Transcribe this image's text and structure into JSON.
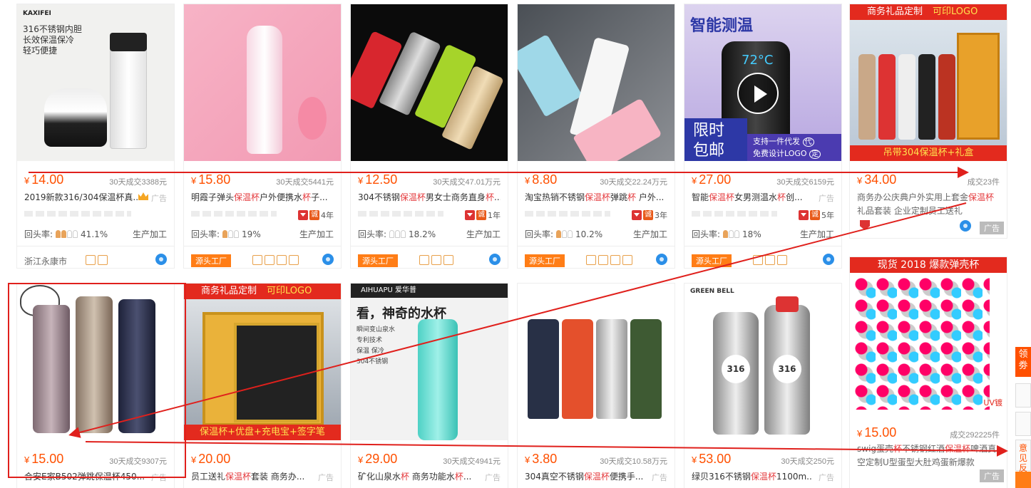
{
  "row1": [
    {
      "price": "15.00",
      "yen": "¥",
      "sales": "30天成交9307元",
      "title": "合安E家B502弹跳保温杯450...",
      "ad": "广告"
    },
    {
      "price": "20.00",
      "yen": "¥",
      "sales": "",
      "title_pre": "员工送礼",
      "title_hl": "保温杯",
      "title_post": "套装 商务办...",
      "ad": "广告"
    },
    {
      "price": "29.00",
      "yen": "¥",
      "sales": "30天成交4941元",
      "title_pre": "矿化山泉水",
      "title_hl": "杯",
      "title_post": " 商务功能水",
      "title_hl2": "杯",
      "title_post2": "...",
      "ad": "广告"
    },
    {
      "price": "3.80",
      "yen": "¥",
      "sales": "30天成交10.58万元",
      "title_pre": "304真空不锈钢",
      "title_hl": "保温杯",
      "title_post": "便携手...",
      "ad": "广告"
    },
    {
      "price": "53.00",
      "yen": "¥",
      "sales": "30天成交250元",
      "title_pre": "绿贝316不锈钢",
      "title_hl": "保温杯",
      "title_post": "1100m...",
      "ad": "广告"
    }
  ],
  "row0": [
    {
      "price": "14.00",
      "yen": "¥",
      "sales": "30天成交3388元",
      "title": "2019新款316/304保温杯真...",
      "ad": "广告",
      "rate": "41.1%",
      "type": "生产加工",
      "rank": "",
      "location": "浙江永康市",
      "img_text": [
        "316不锈钢内胆",
        "长效保温保冷",
        "轻巧便捷"
      ],
      "brand": "KAXIFEI"
    },
    {
      "price": "15.80",
      "yen": "¥",
      "sales": "30天成交5441元",
      "title_pre": "明霞子弹头",
      "title_hl": "保温杯",
      "title_post": "户外便携水",
      "title_hl2": "杯",
      "title_post2": "子...",
      "ad": "",
      "rate": "19%",
      "type": "生产加工",
      "rank": "4年",
      "src": "源头工厂"
    },
    {
      "price": "12.50",
      "yen": "¥",
      "sales": "30天成交47.01万元",
      "title_pre": "304不锈钢",
      "title_hl": "保温杯",
      "title_post": "男女士商务直身",
      "title_hl2": "杯",
      "title_post2": "...",
      "ad": "",
      "rate": "18.2%",
      "type": "生产加工",
      "rank": "1年",
      "src": "源头工厂"
    },
    {
      "price": "8.80",
      "yen": "¥",
      "sales": "30天成交22.24万元",
      "title_pre": "淘宝热销不锈钢",
      "title_hl": "保温杯",
      "title_post": "弹跳",
      "title_hl2": "杯",
      "title_post2": " 户外...",
      "ad": "",
      "rate": "10.2%",
      "type": "生产加工",
      "rank": "3年",
      "src": "源头工厂"
    },
    {
      "price": "27.00",
      "yen": "¥",
      "sales": "30天成交6159元",
      "title_pre": "智能",
      "title_hl": "保温杯",
      "title_post": "女男测温水",
      "title_hl2": "杯",
      "title_post2": "创...",
      "ad": "广告",
      "rate": "18%",
      "type": "生产加工",
      "rank": "5年",
      "src": "源头工厂",
      "img_text": [
        "智能测温",
        "限时",
        "包邮",
        "支持一件代发",
        "免费设计LOGO",
        "代",
        "定"
      ]
    },
    {
      "price": "34.00",
      "yen": "¥",
      "sales": "成交23件",
      "title_pre": "商务办公庆典户外实用上套金",
      "title_hl": "保温杯",
      "title_post2": "礼品套装 企业定制员工送礼",
      "ad": "广告",
      "banner": "商务礼品定制",
      "banner_y": "可印LOGO",
      "banner_bot": "吊带304保温杯+礼盒"
    }
  ],
  "right_col": {
    "price": "15.00",
    "yen": "¥",
    "sales": "成交292225件",
    "title_pre": "swig蛋壳",
    "title_hl": "杯",
    "title_post": "不锈钢红酒",
    "title_hl2": "保温杯",
    "title_post2": "啤酒真",
    "title_line2": "空定制U型蛋型大肚鸡蛋新爆款",
    "ad": "广告",
    "banner": "现货 2018 爆款弹壳杯",
    "uv": "UV镀"
  },
  "row1_card2": {
    "banner": "商务礼品定制",
    "banner_y": "可印LOGO",
    "banner_bot": "保温杯+优盘+充电宝+签字笔"
  },
  "row1_card3": {
    "brand": "AIHUAPU 爱华普",
    "headline": "看，神奇的水杯",
    "bullets": [
      "瞬间变山泉水",
      "专利技术",
      "保温 保冷",
      "304不锈钢"
    ]
  },
  "row1_card5": {
    "brand": "GREEN BELL",
    "tag": "316"
  },
  "rate_label": "回头率:",
  "side": {
    "tab1": "领劵",
    "tab2": "意见反馈"
  },
  "colors": {
    "accent": "#ff5000",
    "arrow": "#e0201c",
    "highlight": "#e4393c"
  }
}
